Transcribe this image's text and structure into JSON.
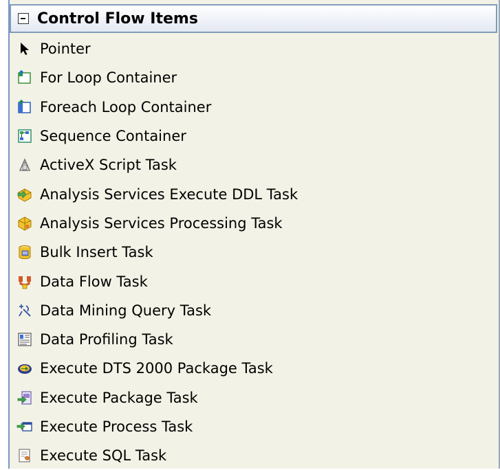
{
  "toolbox": {
    "section_title": "Control Flow Items",
    "items": [
      {
        "label": "Pointer",
        "icon": "pointer-icon"
      },
      {
        "label": "For Loop Container",
        "icon": "for-loop-container-icon"
      },
      {
        "label": "Foreach Loop Container",
        "icon": "foreach-loop-container-icon"
      },
      {
        "label": "Sequence Container",
        "icon": "sequence-container-icon"
      },
      {
        "label": "ActiveX Script Task",
        "icon": "activex-script-icon"
      },
      {
        "label": "Analysis Services Execute DDL Task",
        "icon": "analysis-ddl-icon"
      },
      {
        "label": "Analysis Services Processing Task",
        "icon": "analysis-processing-icon"
      },
      {
        "label": "Bulk Insert Task",
        "icon": "bulk-insert-icon"
      },
      {
        "label": "Data Flow Task",
        "icon": "data-flow-icon"
      },
      {
        "label": "Data Mining Query Task",
        "icon": "data-mining-icon"
      },
      {
        "label": "Data Profiling Task",
        "icon": "data-profiling-icon"
      },
      {
        "label": "Execute DTS 2000 Package Task",
        "icon": "execute-dts-icon"
      },
      {
        "label": "Execute Package Task",
        "icon": "execute-package-icon"
      },
      {
        "label": "Execute Process Task",
        "icon": "execute-process-icon"
      },
      {
        "label": "Execute SQL Task",
        "icon": "execute-sql-icon"
      }
    ]
  },
  "colors": {
    "panel_background": "#f3f2e6",
    "header_border": "#7f9db9",
    "left_border": "#7a96c2"
  }
}
